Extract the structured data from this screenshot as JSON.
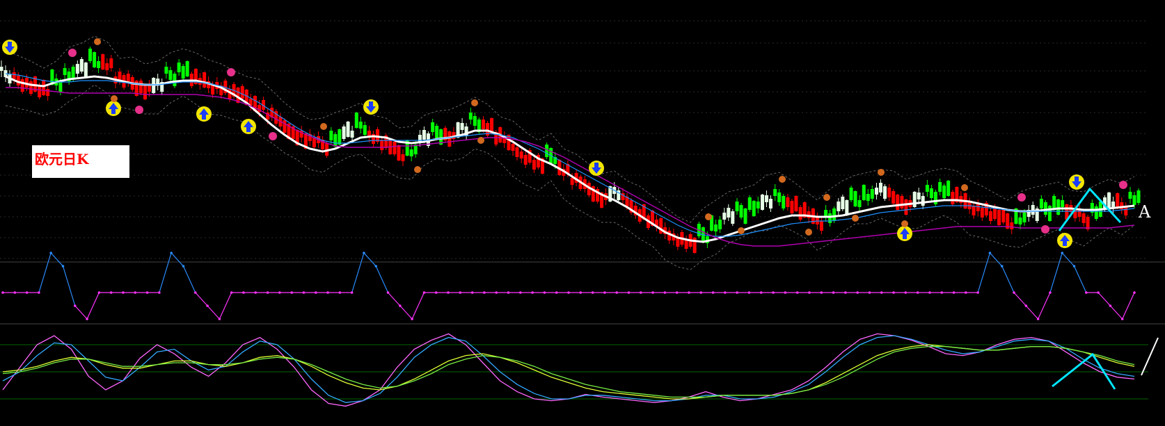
{
  "chart_label": "欧元日K",
  "wave_marker": "A",
  "colors": {
    "background": "#000000",
    "up_candle": "#00ff00",
    "down_candle": "#ff0000",
    "neutral_candle": "#e6ffe6",
    "ma_white": "#ffffff",
    "ma_blue": "#1e90ff",
    "ma_purple": "#b000b0",
    "band": "#6a6a6a",
    "signal_magenta": "#ff33ff",
    "signal_blue": "#2a8cff",
    "osc_pink": "#ff66ff",
    "osc_blue": "#33aaff",
    "osc_yellow": "#e0ff33",
    "osc_green": "#77ee44",
    "osc_white": "#ffffff",
    "cyan_pattern": "#00e5ff",
    "level_line": "#006600",
    "buy_marker": "#f2e600",
    "marker_orange": "#d2691e",
    "marker_magenta": "#e6308a"
  },
  "chart_data": [
    {
      "type": "candlestick",
      "title": "欧元日K",
      "series": [
        {
          "name": "",
          "role": "price",
          "values": [
            62,
            68,
            74,
            82,
            70,
            58,
            50,
            38,
            44,
            66,
            72,
            80,
            74,
            60,
            52,
            66,
            74,
            78,
            86,
            92,
            104,
            118,
            134,
            146,
            154,
            160,
            150,
            142,
            132,
            148,
            160,
            172,
            168,
            150,
            142,
            148,
            138,
            126,
            134,
            150,
            164,
            178,
            188,
            176,
            196,
            212,
            224,
            236,
            230,
            242,
            258,
            270,
            284,
            296,
            302,
            290,
            276,
            262,
            256,
            248,
            242,
            236,
            246,
            258,
            270,
            262,
            248,
            238,
            232,
            226,
            236,
            246,
            238,
            230,
            224,
            236,
            248,
            254,
            262,
            270,
            266,
            258,
            252,
            246,
            256,
            266,
            254,
            244,
            248,
            236
          ]
        },
        {
          "name": "",
          "role": "ma-white",
          "values": [
            62,
            70,
            74,
            76,
            70,
            66,
            64,
            62,
            64,
            68,
            72,
            74,
            74,
            70,
            68,
            68,
            72,
            78,
            88,
            100,
            116,
            132,
            146,
            158,
            166,
            170,
            166,
            158,
            150,
            148,
            150,
            156,
            158,
            156,
            152,
            150,
            146,
            140,
            140,
            146,
            156,
            168,
            180,
            188,
            198,
            210,
            222,
            232,
            240,
            250,
            262,
            274,
            286,
            294,
            298,
            300,
            296,
            290,
            284,
            278,
            272,
            266,
            262,
            262,
            264,
            264,
            262,
            258,
            254,
            250,
            248,
            246,
            244,
            242,
            240,
            240,
            242,
            246,
            250,
            254,
            256,
            256,
            254,
            252,
            252,
            254,
            254,
            252,
            250,
            248
          ]
        },
        {
          "name": "",
          "role": "ma-blue",
          "values": [
            58,
            60,
            64,
            68,
            70,
            70,
            68,
            68,
            68,
            70,
            72,
            74,
            74,
            72,
            70,
            70,
            72,
            76,
            82,
            90,
            100,
            112,
            124,
            136,
            146,
            154,
            158,
            158,
            156,
            154,
            154,
            154,
            154,
            154,
            152,
            150,
            148,
            146,
            144,
            146,
            150,
            158,
            166,
            176,
            186,
            196,
            206,
            216,
            226,
            236,
            246,
            256,
            266,
            276,
            284,
            290,
            292,
            292,
            290,
            286,
            282,
            278,
            274,
            272,
            270,
            270,
            268,
            266,
            262,
            258,
            256,
            254,
            252,
            250,
            248,
            248,
            248,
            250,
            252,
            254,
            256,
            256,
            256,
            256,
            256,
            256,
            256,
            256,
            254,
            252
          ]
        },
        {
          "name": "",
          "role": "ma-purple",
          "values": [
            78,
            78,
            80,
            82,
            84,
            86,
            86,
            86,
            86,
            86,
            86,
            88,
            88,
            88,
            88,
            88,
            90,
            92,
            96,
            102,
            110,
            120,
            130,
            140,
            148,
            156,
            162,
            164,
            164,
            164,
            164,
            162,
            162,
            160,
            158,
            156,
            154,
            152,
            150,
            150,
            152,
            156,
            162,
            170,
            178,
            188,
            198,
            208,
            218,
            228,
            238,
            248,
            258,
            268,
            278,
            286,
            294,
            300,
            304,
            306,
            306,
            306,
            304,
            302,
            300,
            298,
            296,
            294,
            292,
            290,
            288,
            286,
            284,
            282,
            280,
            278,
            278,
            278,
            278,
            278,
            280,
            280,
            280,
            280,
            280,
            280,
            280,
            280,
            278,
            276
          ]
        }
      ],
      "signals": {
        "buy_arrows": [
          163,
          293,
          357,
          1300,
          1530
        ],
        "sell_arrows": [
          14,
          533,
          857,
          1547
        ],
        "orange_markers": [
          140,
          164,
          465,
          600,
          682,
          691,
          1018,
          1065,
          1124,
          1162,
          1188,
          1229,
          1266,
          1300,
          1386
        ],
        "magenta_markers": [
          104,
          200,
          332,
          392,
          1468,
          1502,
          1614
        ]
      }
    },
    {
      "type": "line",
      "title": "",
      "role": "signal-indicator",
      "series": [
        {
          "name": "",
          "values": [
            0,
            0,
            0,
            0,
            3,
            2,
            -1,
            -2,
            0,
            0,
            0,
            0,
            0,
            0,
            3,
            2,
            0,
            -1,
            -2,
            0,
            0,
            0,
            0,
            0,
            0,
            0,
            0,
            0,
            0,
            0,
            3,
            2,
            0,
            -1,
            -2,
            0,
            0,
            0,
            0,
            0,
            0,
            0,
            0,
            0,
            0,
            0,
            0,
            0,
            0,
            0,
            0,
            0,
            0,
            0,
            0,
            0,
            0,
            0,
            0,
            0,
            0,
            0,
            0,
            0,
            0,
            0,
            0,
            0,
            0,
            0,
            0,
            0,
            0,
            0,
            0,
            0,
            0,
            0,
            0,
            0,
            0,
            0,
            3,
            2,
            0,
            -1,
            -2,
            0,
            3,
            2,
            0,
            0,
            -1,
            -2,
            0
          ]
        }
      ]
    },
    {
      "type": "line",
      "title": "",
      "role": "oscillator",
      "levels": [
        80,
        50,
        20
      ],
      "series": [
        {
          "name": "",
          "values": [
            30,
            55,
            80,
            90,
            75,
            45,
            30,
            40,
            65,
            80,
            70,
            55,
            45,
            60,
            80,
            88,
            75,
            55,
            30,
            15,
            12,
            18,
            30,
            55,
            75,
            85,
            92,
            80,
            60,
            40,
            28,
            20,
            18,
            20,
            25,
            22,
            20,
            18,
            16,
            18,
            22,
            28,
            22,
            18,
            20,
            25,
            30,
            40,
            55,
            72,
            86,
            92,
            90,
            85,
            78,
            70,
            68,
            72,
            80,
            86,
            88,
            84,
            72,
            60,
            50,
            44,
            42
          ]
        },
        {
          "name": "",
          "values": [
            40,
            50,
            68,
            82,
            80,
            62,
            44,
            40,
            55,
            72,
            75,
            62,
            52,
            56,
            72,
            84,
            80,
            64,
            42,
            24,
            16,
            18,
            26,
            44,
            66,
            80,
            88,
            84,
            68,
            50,
            36,
            26,
            20,
            20,
            24,
            24,
            22,
            20,
            18,
            18,
            20,
            24,
            24,
            20,
            20,
            22,
            28,
            36,
            50,
            66,
            80,
            88,
            90,
            86,
            80,
            74,
            70,
            72,
            78,
            84,
            86,
            84,
            76,
            64,
            54,
            48,
            45
          ]
        },
        {
          "name": "",
          "values": [
            50,
            52,
            56,
            62,
            66,
            64,
            58,
            54,
            54,
            58,
            62,
            62,
            58,
            56,
            60,
            66,
            68,
            64,
            56,
            46,
            38,
            32,
            30,
            34,
            42,
            52,
            62,
            68,
            70,
            66,
            60,
            52,
            44,
            38,
            32,
            28,
            26,
            24,
            22,
            20,
            20,
            22,
            24,
            24,
            24,
            24,
            26,
            30,
            38,
            48,
            58,
            68,
            74,
            78,
            80,
            78,
            76,
            74,
            74,
            76,
            78,
            78,
            76,
            72,
            66,
            60,
            56
          ]
        },
        {
          "name": "",
          "values": [
            48,
            50,
            54,
            60,
            64,
            64,
            60,
            56,
            56,
            58,
            60,
            60,
            58,
            58,
            60,
            64,
            66,
            64,
            58,
            50,
            42,
            36,
            32,
            34,
            40,
            48,
            58,
            64,
            68,
            66,
            62,
            56,
            48,
            42,
            36,
            32,
            28,
            26,
            24,
            22,
            22,
            22,
            24,
            24,
            24,
            24,
            26,
            30,
            36,
            44,
            54,
            64,
            72,
            76,
            78,
            78,
            76,
            74,
            74,
            76,
            78,
            78,
            76,
            72,
            68,
            62,
            58
          ]
        }
      ]
    }
  ]
}
